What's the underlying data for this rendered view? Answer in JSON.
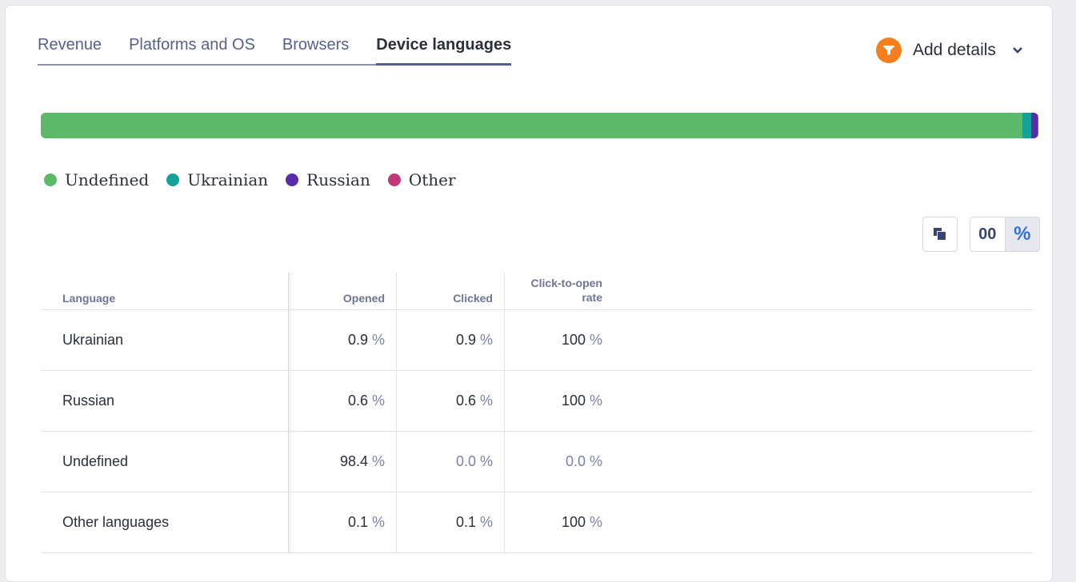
{
  "tabs": [
    {
      "label": "Revenue",
      "active": false
    },
    {
      "label": "Platforms and OS",
      "active": false
    },
    {
      "label": "Browsers",
      "active": false
    },
    {
      "label": "Device languages",
      "active": true
    }
  ],
  "add_details": {
    "label": "Add details",
    "icon": "funnel-icon"
  },
  "bar": {
    "segments": [
      {
        "name": "Undefined",
        "value": 98.4,
        "color": "#5cb96a"
      },
      {
        "name": "Ukrainian",
        "value": 0.9,
        "color": "#13a19a"
      },
      {
        "name": "Russian",
        "value": 0.6,
        "color": "#5a2ca8"
      },
      {
        "name": "Other",
        "value": 0.1,
        "color": "#c0377a"
      }
    ]
  },
  "legend": [
    {
      "label": "Undefined",
      "color": "#5cb96a"
    },
    {
      "label": "Ukrainian",
      "color": "#13a19a"
    },
    {
      "label": "Russian",
      "color": "#5a2ca8"
    },
    {
      "label": "Other",
      "color": "#c0377a"
    }
  ],
  "controls": {
    "copy_icon": "copy-icon",
    "toggle_number": "00",
    "toggle_percent": "%"
  },
  "table": {
    "headers": {
      "language": "Language",
      "opened": "Opened",
      "clicked": "Clicked",
      "rate": "Click-to-open rate"
    },
    "unit": "%",
    "rows": [
      {
        "language": "Ukrainian",
        "opened": "0.9",
        "clicked": "0.9",
        "rate": "100"
      },
      {
        "language": "Russian",
        "opened": "0.6",
        "clicked": "0.6",
        "rate": "100"
      },
      {
        "language": "Undefined",
        "opened": "98.4",
        "clicked": "0.0",
        "rate": "0.0"
      },
      {
        "language": "Other languages",
        "opened": "0.1",
        "clicked": "0.1",
        "rate": "100"
      }
    ]
  }
}
